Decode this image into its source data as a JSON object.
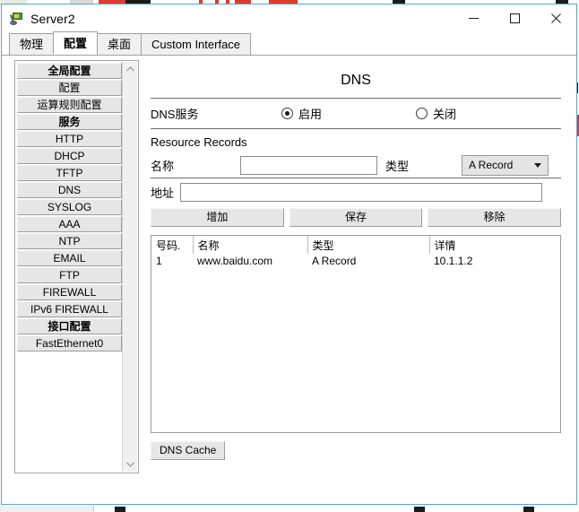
{
  "window": {
    "title": "Server2",
    "icon": "server-flag-icon",
    "controls": {
      "minimize": "minimize-icon",
      "maximize": "maximize-icon",
      "close": "close-icon"
    }
  },
  "tabs": [
    {
      "label": "物理",
      "active": false
    },
    {
      "label": "配置",
      "active": true
    },
    {
      "label": "桌面",
      "active": false
    },
    {
      "label": "Custom Interface",
      "active": false
    }
  ],
  "sidebar": {
    "items": [
      {
        "label": "全局配置",
        "header": true
      },
      {
        "label": "配置",
        "header": false
      },
      {
        "label": "运算规则配置",
        "header": false
      },
      {
        "label": "服务",
        "header": true
      },
      {
        "label": "HTTP",
        "header": false
      },
      {
        "label": "DHCP",
        "header": false
      },
      {
        "label": "TFTP",
        "header": false
      },
      {
        "label": "DNS",
        "header": false
      },
      {
        "label": "SYSLOG",
        "header": false
      },
      {
        "label": "AAA",
        "header": false
      },
      {
        "label": "NTP",
        "header": false
      },
      {
        "label": "EMAIL",
        "header": false
      },
      {
        "label": "FTP",
        "header": false
      },
      {
        "label": "FIREWALL",
        "header": false
      },
      {
        "label": "IPv6 FIREWALL",
        "header": false
      },
      {
        "label": "接口配置",
        "header": true
      },
      {
        "label": "FastEthernet0",
        "header": false
      }
    ],
    "scrollbar": {
      "up": "▲",
      "down": "▼"
    }
  },
  "main": {
    "title": "DNS",
    "service_label": "DNS服务",
    "radio_on": "启用",
    "radio_off": "关闭",
    "radio_selected": "启用",
    "resource_records_label": "Resource Records",
    "name_label": "名称",
    "name_value": "",
    "name_placeholder": "",
    "type_label": "类型",
    "type_value": "A Record",
    "address_label": "地址",
    "address_value": "",
    "address_placeholder": "",
    "buttons": {
      "add": "增加",
      "save": "保存",
      "remove": "移除"
    },
    "table": {
      "columns": [
        "号码.",
        "名称",
        "类型",
        "详情"
      ],
      "rows": [
        [
          "1",
          "www.baidu.com",
          "A Record",
          "10.1.1.2"
        ]
      ]
    },
    "cache_button": "DNS Cache"
  },
  "colors": {
    "window_border": "#5aa2d8",
    "accent_red": "#e03a2f",
    "button_face": "#e6e6e6"
  }
}
